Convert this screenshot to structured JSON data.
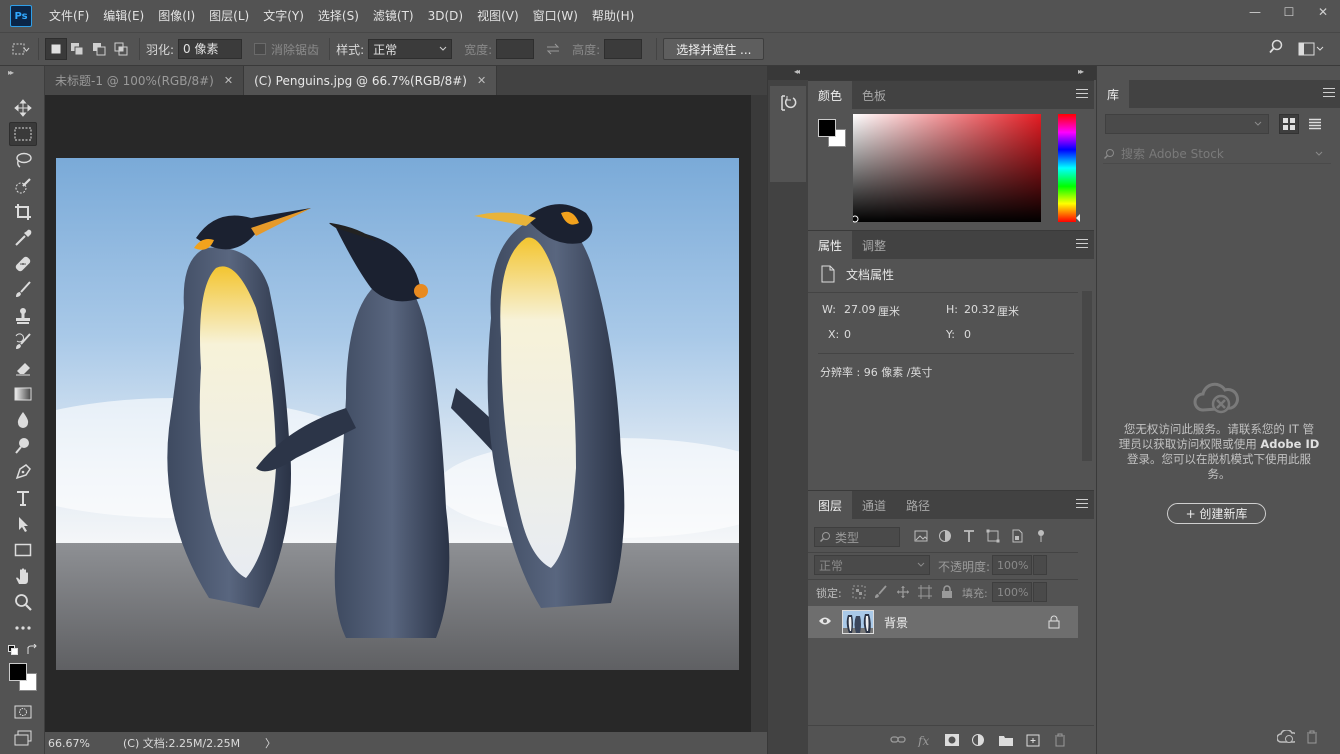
{
  "app": {
    "logo": "Ps"
  },
  "menu": [
    "文件(F)",
    "编辑(E)",
    "图像(I)",
    "图层(L)",
    "文字(Y)",
    "选择(S)",
    "滤镜(T)",
    "3D(D)",
    "视图(V)",
    "窗口(W)",
    "帮助(H)"
  ],
  "window": {
    "minimize": "—",
    "maximize": "☐",
    "close": "✕"
  },
  "options": {
    "feather_label": "羽化:",
    "feather_value": "0 像素",
    "antialias_label": "消除锯齿",
    "style_label": "样式:",
    "style_value": "正常",
    "width_label": "宽度:",
    "height_label": "高度:",
    "select_mask_button": "选择并遮住 ..."
  },
  "tabs": [
    {
      "label": "未标题-1 @ 100%(RGB/8#)",
      "close": "✕"
    },
    {
      "label": "(C) Penguins.jpg @ 66.7%(RGB/8#)",
      "close": "✕"
    }
  ],
  "status": {
    "zoom": "66.67%",
    "doc": "(C) 文档:2.25M/2.25M",
    "arrow": "〉"
  },
  "color_panel": {
    "tabs": [
      "颜色",
      "色板"
    ]
  },
  "properties_panel": {
    "tabs": [
      "属性",
      "调整"
    ],
    "title": "文档属性",
    "w_label": "W:",
    "w_value": "27.09",
    "w_unit": "厘米",
    "h_label": "H:",
    "h_value": "20.32",
    "h_unit": "厘米",
    "x_label": "X:",
    "x_value": "0",
    "y_label": "Y:",
    "y_value": "0",
    "resolution": "分辨率 : 96 像素 /英寸"
  },
  "layers_panel": {
    "tabs": [
      "图层",
      "通道",
      "路径"
    ],
    "filter_label": "类型",
    "blend_mode": "正常",
    "opacity_label": "不透明度:",
    "opacity_value": "100%",
    "lock_label": "锁定:",
    "fill_label": "填充:",
    "fill_value": "100%",
    "layer_name": "背景"
  },
  "library": {
    "tab": "库",
    "search_placeholder": "搜索 Adobe Stock",
    "message_line1": "您无权访问此服务。请联系您的 IT 管",
    "message_line2_pre": "理员以获取访问权限或使用 ",
    "message_line2_bold": "Adobe ID",
    "message_line3": "登录。您可以在脱机模式下使用此服",
    "message_line4": "务。",
    "create_button": "+ 创建新库"
  },
  "colors": {
    "accent": "#31a8ff",
    "ui_bg": "#535353",
    "canvas_bg": "#282828"
  }
}
